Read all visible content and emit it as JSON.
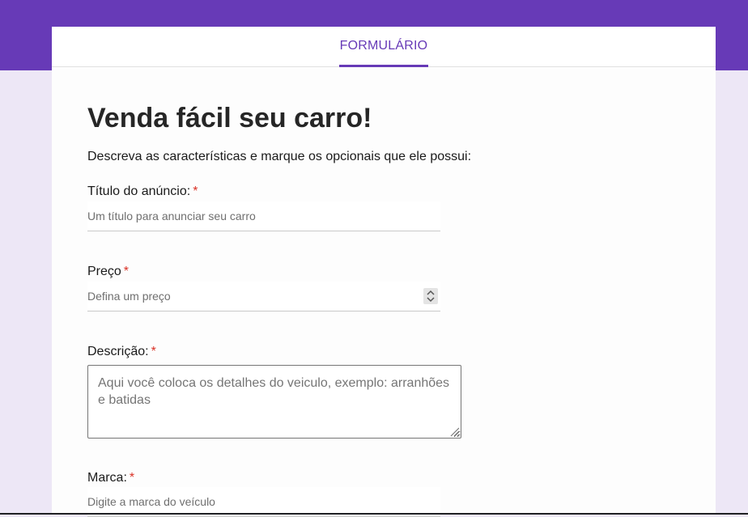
{
  "tabs": [
    {
      "label": "FORMULÁRIO",
      "active": true
    }
  ],
  "form": {
    "title": "Venda fácil seu carro!",
    "description": "Descreva as características e marque os opcionais que ele possui:",
    "required_marker": "*",
    "fields": {
      "titulo": {
        "label": "Título do anúncio:",
        "placeholder": "Um título para anunciar seu carro",
        "value": ""
      },
      "preco": {
        "label": "Preço",
        "placeholder": "Defina um preço",
        "value": ""
      },
      "descricao": {
        "label": "Descrição:",
        "placeholder": "Aqui você coloca os detalhes do veiculo, exemplo: arranhões e batidas",
        "value": ""
      },
      "marca": {
        "label": "Marca:",
        "placeholder": "Digite a marca do veículo",
        "value": ""
      }
    }
  },
  "colors": {
    "accent": "#673ab7",
    "background": "#ede7f6",
    "required": "#d93025"
  },
  "icons": {
    "spinner": "up-down-chevrons-icon",
    "resize": "resize-grip-icon"
  }
}
